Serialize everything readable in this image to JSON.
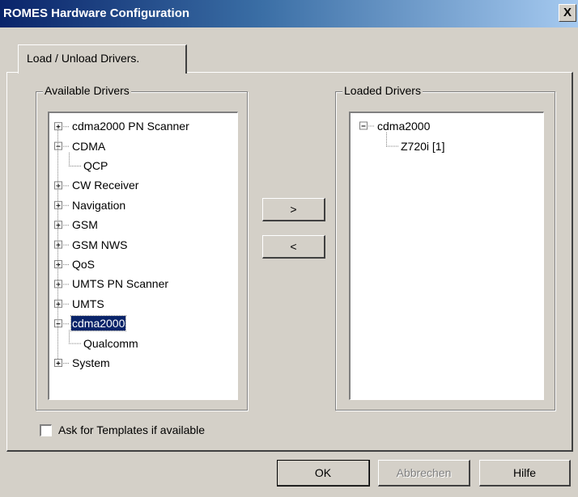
{
  "window": {
    "title": "ROMES Hardware Configuration",
    "close_label": "X"
  },
  "tabs": [
    {
      "label": "Load / Unload Drivers.",
      "selected": true
    }
  ],
  "available_drivers": {
    "label": "Available Drivers",
    "items": [
      {
        "label": "cdma2000 PN Scanner",
        "level": 0,
        "expander": "plus"
      },
      {
        "label": "CDMA",
        "level": 0,
        "expander": "minus"
      },
      {
        "label": "QCP",
        "level": 1,
        "expander": "none"
      },
      {
        "label": "CW Receiver",
        "level": 0,
        "expander": "plus"
      },
      {
        "label": "Navigation",
        "level": 0,
        "expander": "plus"
      },
      {
        "label": "GSM",
        "level": 0,
        "expander": "plus"
      },
      {
        "label": "GSM NWS",
        "level": 0,
        "expander": "plus"
      },
      {
        "label": "QoS",
        "level": 0,
        "expander": "plus"
      },
      {
        "label": "UMTS PN Scanner",
        "level": 0,
        "expander": "plus"
      },
      {
        "label": "UMTS",
        "level": 0,
        "expander": "plus"
      },
      {
        "label": "cdma2000",
        "level": 0,
        "expander": "minus",
        "selected": true
      },
      {
        "label": "Qualcomm",
        "level": 1,
        "expander": "none"
      },
      {
        "label": "System",
        "level": 0,
        "expander": "plus"
      }
    ]
  },
  "loaded_drivers": {
    "label": "Loaded Drivers",
    "items": [
      {
        "label": "cdma2000",
        "level": 0,
        "expander": "minus"
      },
      {
        "label": "Z720i [1]",
        "level": 1,
        "expander": "none"
      }
    ]
  },
  "move_buttons": {
    "add_label": ">",
    "remove_label": "<"
  },
  "options": {
    "ask_templates_label": "Ask for Templates if available",
    "ask_templates_checked": false
  },
  "footer": {
    "ok_label": "OK",
    "cancel_label": "Abbrechen",
    "help_label": "Hilfe"
  },
  "colors": {
    "selection_bg": "#0a246a",
    "face": "#d4d0c8"
  }
}
